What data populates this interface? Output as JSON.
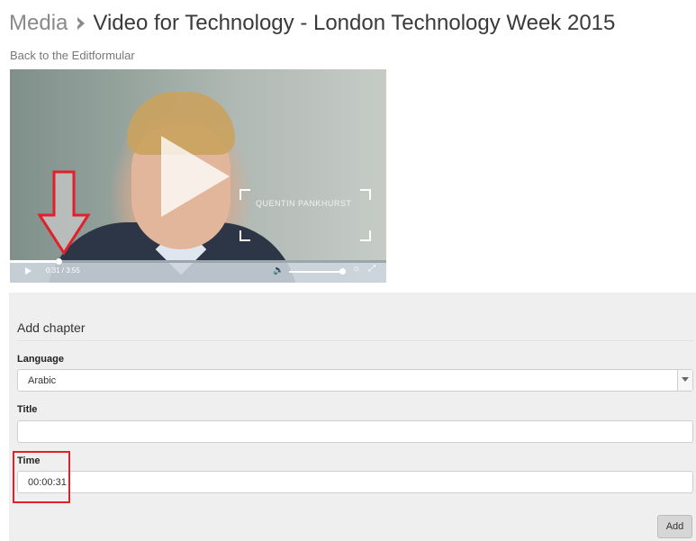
{
  "header": {
    "breadcrumb_root": "Media",
    "page_title": "Video for Technology - London Technology Week 2015"
  },
  "back_link": "Back to the Editformular",
  "video": {
    "lower_third_name": "QUENTIN PANKHURST",
    "time_display": "0:31 / 3:55",
    "progress_fraction": 0.132
  },
  "form": {
    "section_title": "Add chapter",
    "language": {
      "label": "Language",
      "value": "Arabic"
    },
    "title": {
      "label": "Title",
      "value": ""
    },
    "time": {
      "label": "Time",
      "value": "00:00:31"
    },
    "add_button": "Add"
  },
  "colors": {
    "highlight": "#e0202b",
    "panel_bg": "#efefef"
  }
}
